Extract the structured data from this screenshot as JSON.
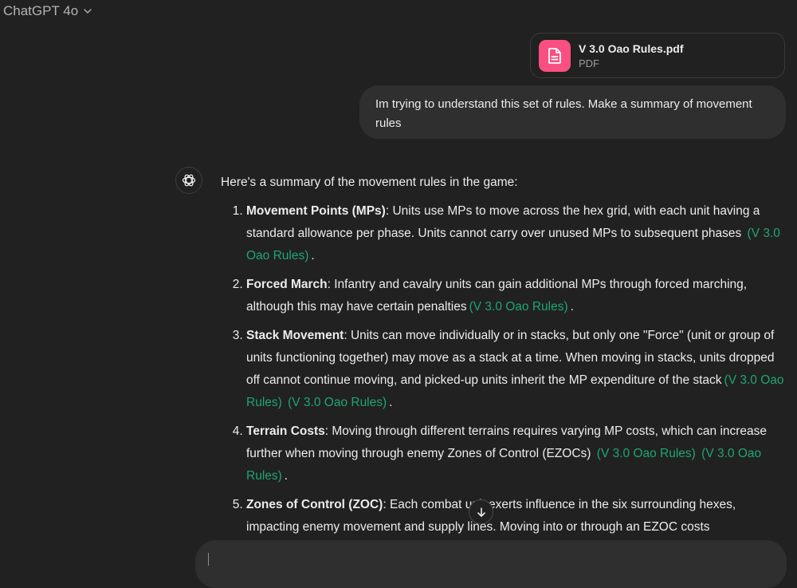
{
  "header": {
    "model_name": "ChatGPT 4o"
  },
  "attachment": {
    "file_name": "V 3.0 Oao Rules.pdf",
    "file_type": "PDF"
  },
  "user_message": {
    "text": "Im trying to understand this set of rules. Make a summary of movement rules"
  },
  "assistant_message": {
    "intro": "Here's a summary of the movement rules in the game:",
    "items": [
      {
        "term": "Movement Points (MPs)",
        "text": ": Units use MPs to move across the hex grid, with each unit having a standard allowance per phase. Units cannot carry over unused MPs to subsequent phases",
        "citations": [
          "(V 3.0 Oao Rules)"
        ]
      },
      {
        "term": "Forced March",
        "text": ": Infantry and cavalry units can gain additional MPs through forced marching, although this may have certain penalties",
        "citations": [
          "(V 3.0 Oao Rules)"
        ]
      },
      {
        "term": "Stack Movement",
        "text": ": Units can move individually or in stacks, but only one \"Force\" (unit or group of units functioning together) may move as a stack at a time. When moving in stacks, units dropped off cannot continue moving, and picked-up units inherit the MP expenditure of the stack",
        "citations": [
          "(V 3.0 Oao Rules)",
          "(V 3.0 Oao Rules)"
        ]
      },
      {
        "term": "Terrain Costs",
        "text": ": Moving through different terrains requires varying MP costs, which can increase further when moving through enemy Zones of Control (EZOCs)",
        "citations": [
          "(V 3.0 Oao Rules)",
          "(V 3.0 Oao Rules)"
        ]
      },
      {
        "term": "Zones of Control (ZOC)",
        "text": ": Each combat unit exerts influence in the six surrounding hexes, impacting enemy movement and supply lines. Moving into or through an EZOC costs"
      }
    ],
    "period": "."
  },
  "icons": {
    "model_chevron": "chevron-down-icon",
    "file": "document-icon",
    "assistant": "openai-logo-icon",
    "scroll": "arrow-down-icon"
  },
  "colors": {
    "background": "#212121",
    "user_bubble": "#2f2f2f",
    "citation": "#1ea672",
    "file_icon": "#fa4f81"
  }
}
